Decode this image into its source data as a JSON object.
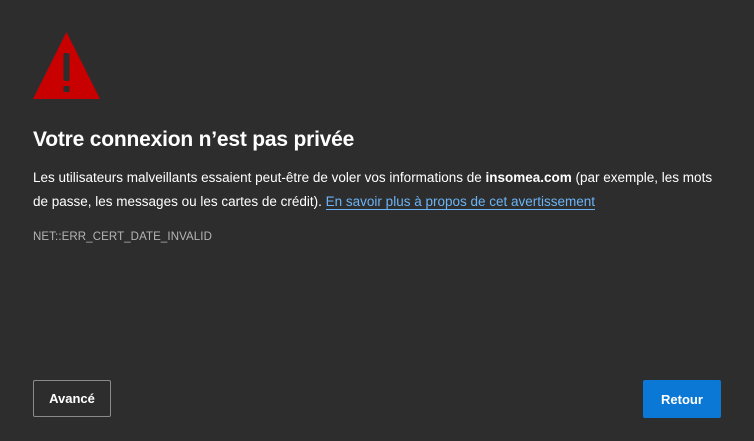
{
  "icon": {
    "name": "warning-triangle-icon",
    "color": "#c80000"
  },
  "title": "Votre connexion n’est pas privée",
  "description": {
    "before": "Les utilisateurs malveillants essaient peut-être de voler vos informations de ",
    "domain": "insomea.com",
    "after": " (par exemple, les mots de passe, les messages ou les cartes de crédit). ",
    "link_label": "En savoir plus à propos de cet avertissement"
  },
  "error_code": "NET::ERR_CERT_DATE_INVALID",
  "buttons": {
    "advanced_label": "Avancé",
    "back_label": "Retour"
  },
  "colors": {
    "background": "#2d2d2d",
    "link": "#6cb4f6",
    "primary_button": "#0b78d6"
  }
}
